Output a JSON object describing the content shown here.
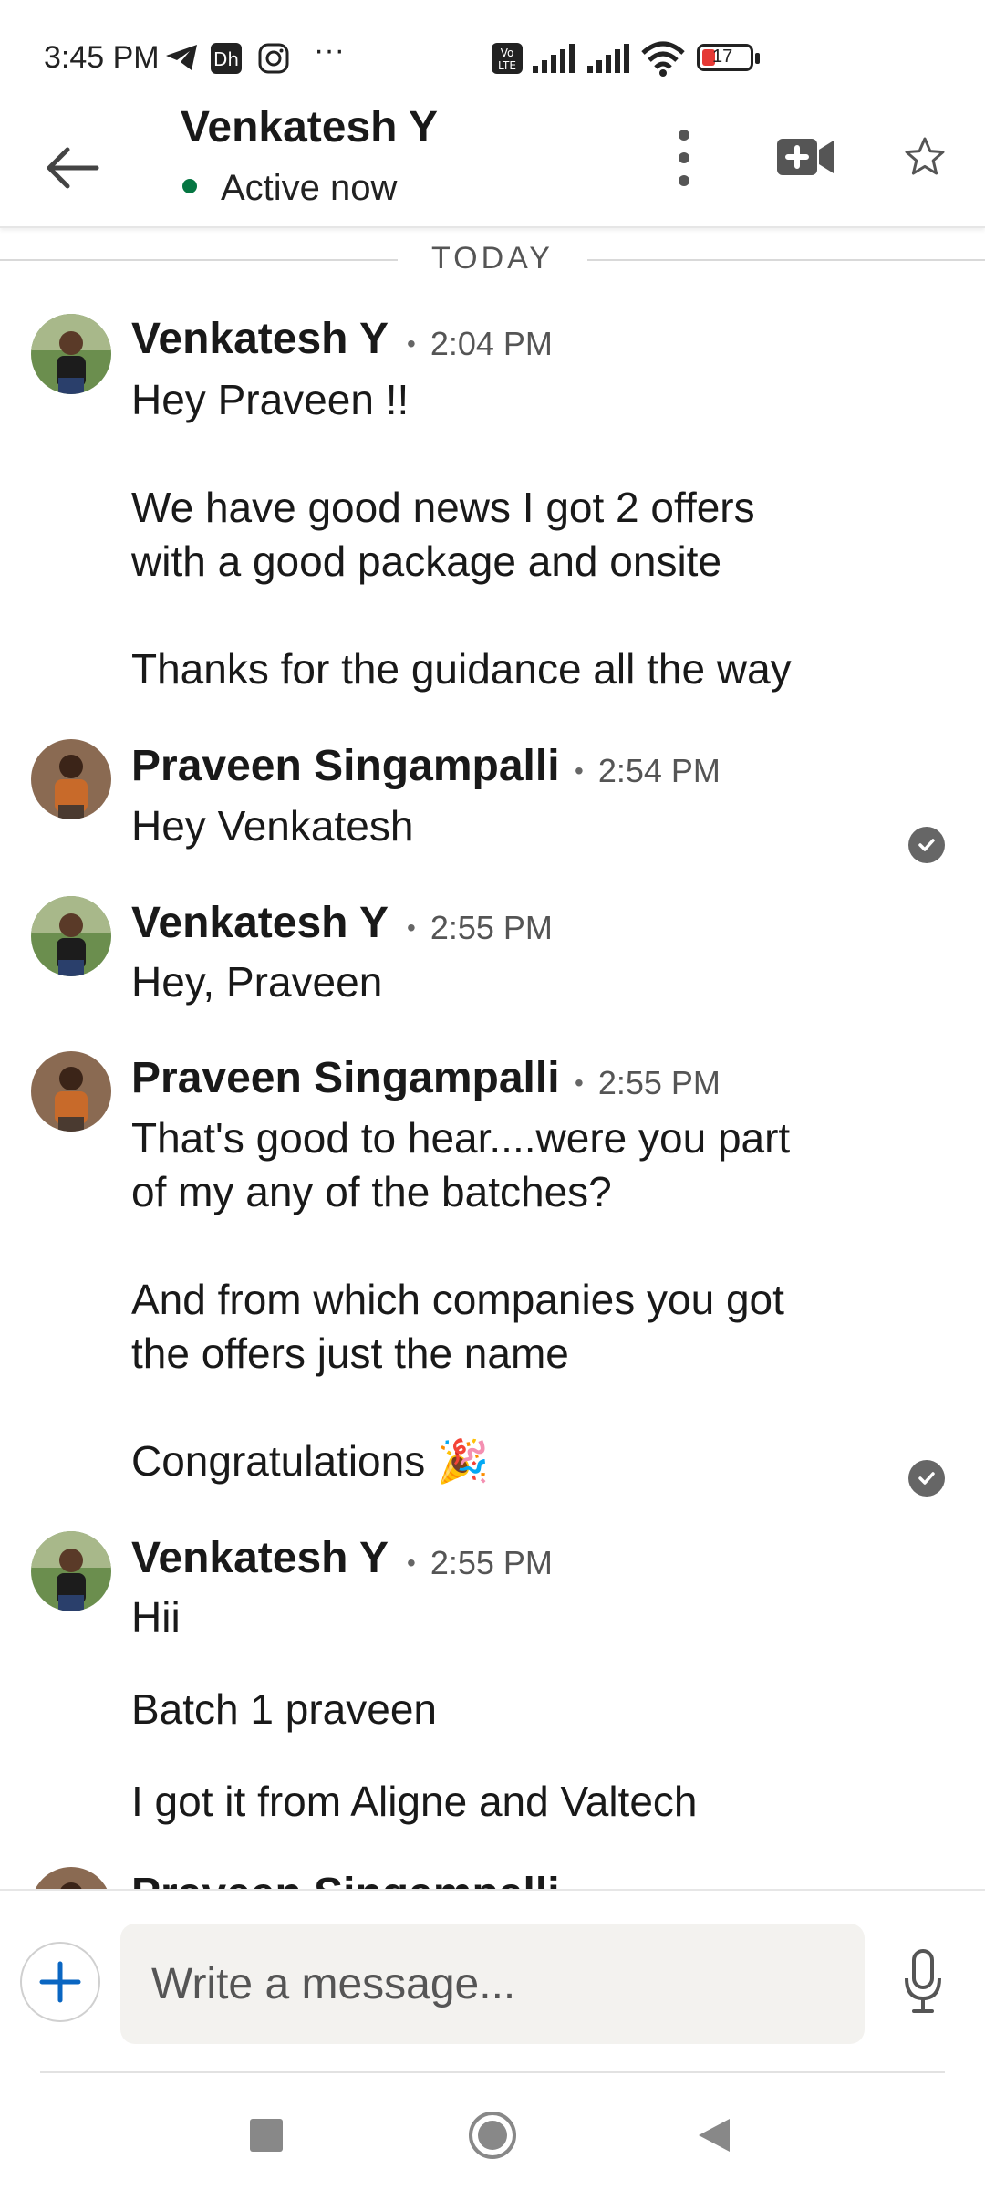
{
  "status_bar": {
    "time": "3:45 PM",
    "battery": "17",
    "more": "···"
  },
  "header": {
    "name": "Venkatesh Y",
    "status": "Active now"
  },
  "divider": {
    "label": "TODAY"
  },
  "messages": [
    {
      "sender": "Venkatesh Y",
      "time": "2:04 PM",
      "lines": [
        "Hey Praveen !!",
        "",
        "We have good news I got 2 offers",
        "with a good package and onsite",
        "",
        "Thanks for the guidance all the way"
      ]
    },
    {
      "sender": "Praveen Singampalli",
      "time": "2:54 PM",
      "lines": [
        "Hey Venkatesh"
      ]
    },
    {
      "sender": "Venkatesh Y",
      "time": "2:55 PM",
      "lines": [
        "Hey, Praveen"
      ]
    },
    {
      "sender": "Praveen Singampalli",
      "time": "2:55 PM",
      "lines": [
        "That's good to hear....were you part",
        "of my any of the batches?",
        "",
        "And from which companies you got",
        "the offers just the name",
        "",
        "Congratulations 🎉"
      ]
    },
    {
      "sender": "Venkatesh Y",
      "time": "2:55 PM",
      "lines": [
        "Hii",
        "Batch 1 praveen",
        "I got it from Aligne and Valtech"
      ]
    },
    {
      "sender": "Praveen Singampalli",
      "time": "",
      "lines": []
    }
  ],
  "composer": {
    "placeholder": "Write a message..."
  },
  "colors": {
    "active_green": "#057642",
    "accent_blue": "#0a66c2",
    "text": "#191919"
  },
  "icons": {
    "back": "arrow-left-icon",
    "more": "more-vertical-icon",
    "video": "video-plus-icon",
    "star": "star-outline-icon",
    "check": "check-circle-icon",
    "plus": "plus-icon",
    "mic": "microphone-icon"
  }
}
